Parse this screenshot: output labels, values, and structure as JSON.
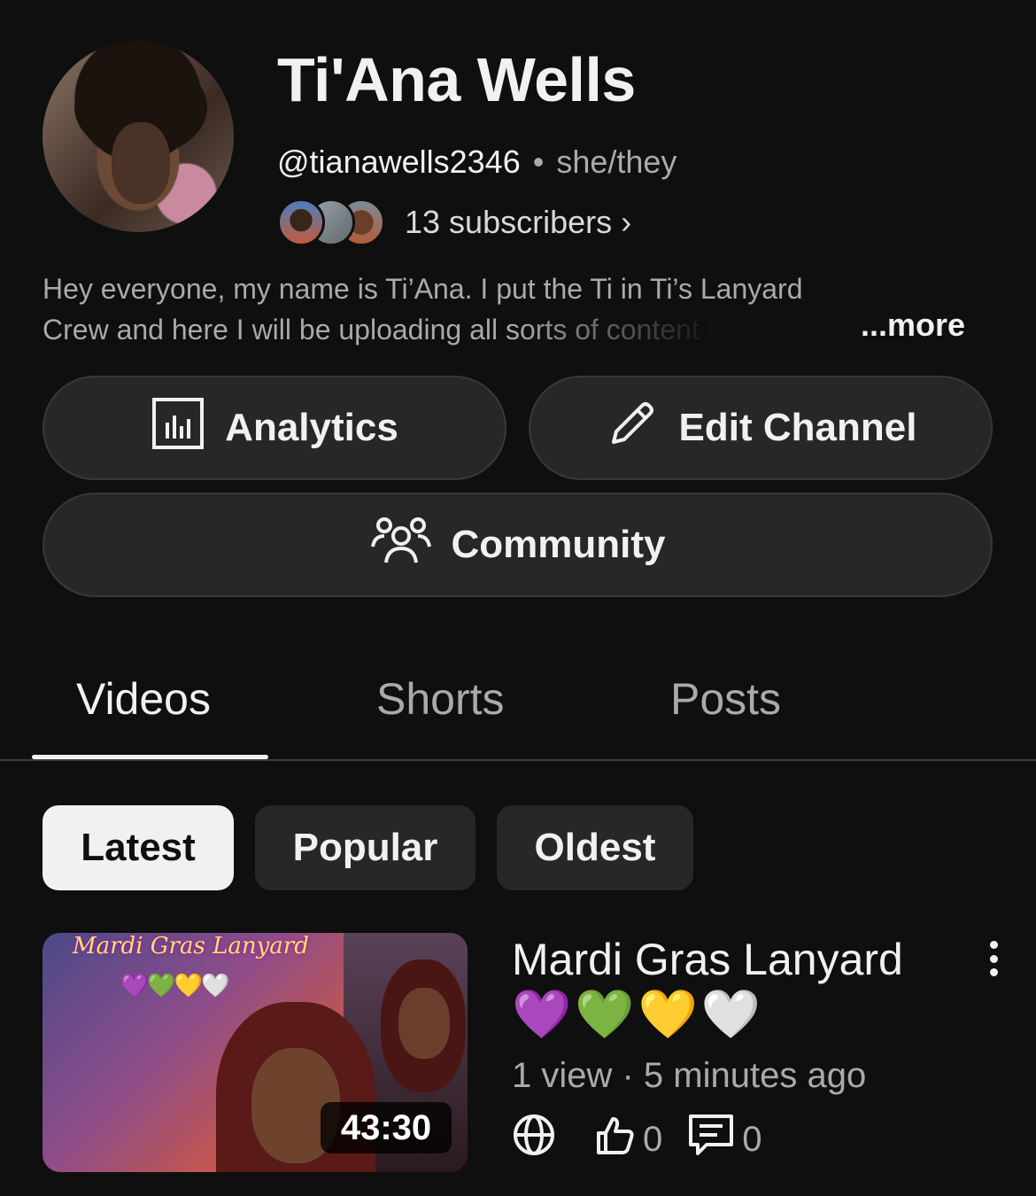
{
  "channel": {
    "name": "Ti'Ana Wells",
    "handle": "@tianawells2346",
    "separator": "•",
    "pronouns": "she/they",
    "subscribers": "13 subscribers",
    "subscribers_chevron": "›",
    "description_line1": "Hey everyone, my name is Ti’Ana. I put the Ti in Ti’s Lanyard",
    "description_line2": "Crew and here I will be uploading all sorts of content f",
    "more_label": "...more"
  },
  "actions": {
    "analytics_label": "Analytics",
    "edit_label": "Edit Channel",
    "community_label": "Community"
  },
  "tabs": [
    {
      "label": "Videos",
      "active": true
    },
    {
      "label": "Shorts",
      "active": false
    },
    {
      "label": "Posts",
      "active": false
    }
  ],
  "filters": [
    {
      "label": "Latest",
      "selected": true
    },
    {
      "label": "Popular",
      "selected": false
    },
    {
      "label": "Oldest",
      "selected": false
    }
  ],
  "video": {
    "thumbnail_text": "Mardi Gras Lanyard",
    "thumbnail_hearts": "💜💚💛🤍",
    "duration": "43:30",
    "title": "Mardi Gras Lanyard",
    "title_hearts": "💜💚💛🤍",
    "meta": "1 view · 5 minutes ago",
    "likes": "0",
    "comments": "0",
    "visibility_icon": "globe-icon"
  },
  "colors": {
    "background": "#0f0f0f",
    "button_bg": "#272727",
    "chip_selected_bg": "#f1f1f1",
    "secondary_text": "#aaaaaa"
  }
}
